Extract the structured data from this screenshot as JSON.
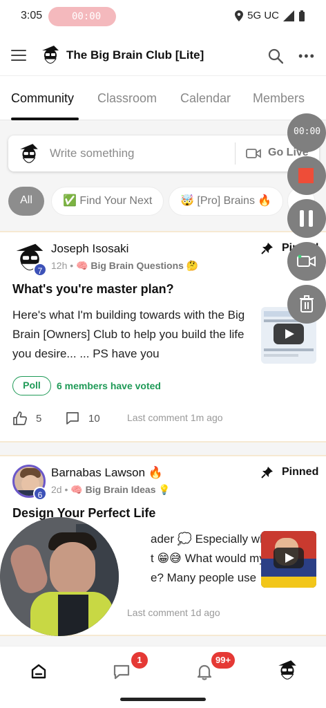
{
  "status_bar": {
    "time": "3:05",
    "recording_timer": "00:00",
    "network": "5G UC"
  },
  "app_bar": {
    "title": "The Big Brain Club [Lite]",
    "icons": [
      "menu-icon",
      "search-icon",
      "more-icon"
    ]
  },
  "tabs": [
    {
      "label": "Community",
      "active": true
    },
    {
      "label": "Classroom",
      "active": false
    },
    {
      "label": "Calendar",
      "active": false
    },
    {
      "label": "Members",
      "active": false
    }
  ],
  "composer": {
    "placeholder": "Write something",
    "go_live_label": "Go Live"
  },
  "filters": [
    {
      "label": "All",
      "selected": true
    },
    {
      "label": "✅ Find Your Next",
      "selected": false
    },
    {
      "label": "🤯 [Pro] Brains 🔥",
      "selected": false
    }
  ],
  "posts": [
    {
      "author": "Joseph Isosaki",
      "level": "7",
      "time": "12h",
      "category": "🧠 Big Brain Questions 🤔",
      "pinned_label": "Pinned",
      "title": "What's you're master plan?",
      "body": "Here's what I'm building towards with the Big Brain [Owners] Club to help you build the life you desire... ... PS have you",
      "poll_label": "Poll",
      "poll_text": "6 members have voted",
      "likes": "5",
      "comments": "10",
      "last_comment": "Last comment 1m ago"
    },
    {
      "author": "Barnabas Lawson 🔥",
      "level": "6",
      "time": "2d",
      "category": "🧠 Big Brain Ideas 💡",
      "pinned_label": "Pinned",
      "title": "Design Your Perfect Life",
      "body_line1": "ader 💭 Especially when",
      "body_line2": "t 😁😅 What would my",
      "body_line3": "e? Many people use",
      "last_comment": "Last comment 1d ago"
    }
  ],
  "recorder": {
    "timer": "00:00"
  },
  "bottom_nav": {
    "chat_badge": "1",
    "notifications_badge": "99+"
  },
  "colors": {
    "accent_green": "#1f9a57",
    "level_blue": "#3d52b8",
    "badge_red": "#e53935",
    "stop_red": "#ee4d38",
    "card_border": "#f6e9d2"
  }
}
